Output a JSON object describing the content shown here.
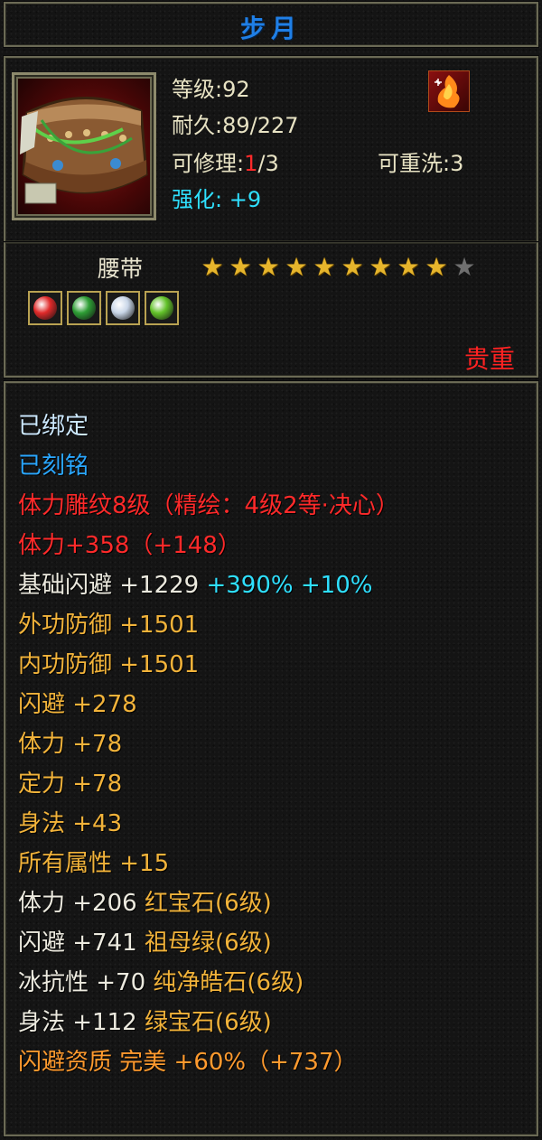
{
  "item": {
    "name": "步月",
    "type": "腰带",
    "quality": "贵重",
    "stars_total": 10,
    "stars_filled": 9,
    "gems": [
      {
        "name": "红宝石",
        "color": "#e02a2a"
      },
      {
        "name": "祖母绿",
        "color": "#2e9e35"
      },
      {
        "name": "纯净皓石",
        "color": "#c9d6e8"
      },
      {
        "name": "绿宝石",
        "color": "#63c22a"
      }
    ]
  },
  "info": {
    "level": "等级:92",
    "durability": "耐久:89/227",
    "repair_label": "可修理:",
    "repair_current": "1",
    "repair_total": "/3",
    "rewash": "可重洗:3",
    "enhance_label": "强化:",
    "enhance_value": "+9"
  },
  "stats": [
    {
      "text": "已绑定",
      "color": "light-cyan"
    },
    {
      "text": "已刻铭",
      "color": "blue"
    },
    {
      "text": "体力雕纹8级（精绘：4级2等·决心）",
      "color": "red-text"
    },
    {
      "text": "体力+358（+148）",
      "color": "red-text"
    },
    {
      "text": "基础闪避 +1229",
      "extra": " +390% +10%",
      "color": "white"
    },
    {
      "text": "外功防御 +1501",
      "color": "gold"
    },
    {
      "text": "内功防御 +1501",
      "color": "gold"
    },
    {
      "text": "闪避 +278",
      "color": "gold"
    },
    {
      "text": "体力 +78",
      "color": "gold"
    },
    {
      "text": "定力 +78",
      "color": "gold"
    },
    {
      "text": "身法 +43",
      "color": "gold"
    },
    {
      "text": "所有属性 +15",
      "color": "gold"
    },
    {
      "text": "体力 +206",
      "gem": " 红宝石(6级)",
      "color": "white"
    },
    {
      "text": "闪避 +741",
      "gem": " 祖母绿(6级)",
      "color": "white"
    },
    {
      "text": "冰抗性 +70",
      "gem": " 纯净皓石(6级)",
      "color": "white"
    },
    {
      "text": "身法 +112",
      "gem": " 绿宝石(6级)",
      "color": "white"
    },
    {
      "text": "闪避资质  完美 +60%（+737）",
      "color": "orange"
    }
  ]
}
